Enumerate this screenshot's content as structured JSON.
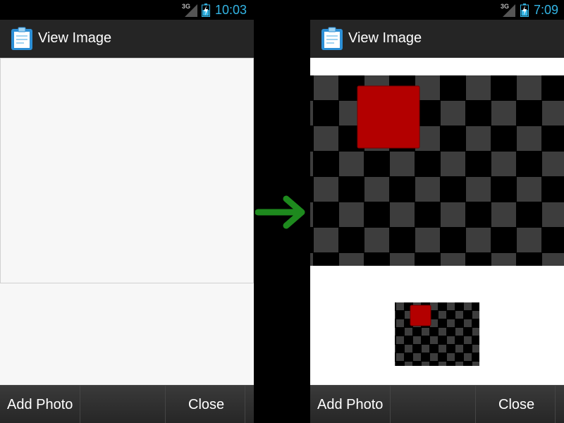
{
  "left_screen": {
    "status_bar": {
      "network": "3G",
      "time": "10:03",
      "time_color": "#33b5e5"
    },
    "action_bar": {
      "title": "View Image",
      "icon": "clipboard-icon"
    },
    "bottom_bar": {
      "add_photo_label": "Add Photo",
      "close_label": "Close"
    }
  },
  "right_screen": {
    "status_bar": {
      "network": "3G",
      "time": "7:09",
      "time_color": "#33b5e5"
    },
    "action_bar": {
      "title": "View Image",
      "icon": "clipboard-icon"
    },
    "bottom_bar": {
      "add_photo_label": "Add Photo",
      "close_label": "Close"
    }
  },
  "transition_arrow": {
    "icon": "right-arrow-icon",
    "color": "#1e8a1e"
  },
  "colors": {
    "checker_dark": "#000000",
    "checker_light": "#3d3d3d",
    "red_square": "#b30000"
  }
}
